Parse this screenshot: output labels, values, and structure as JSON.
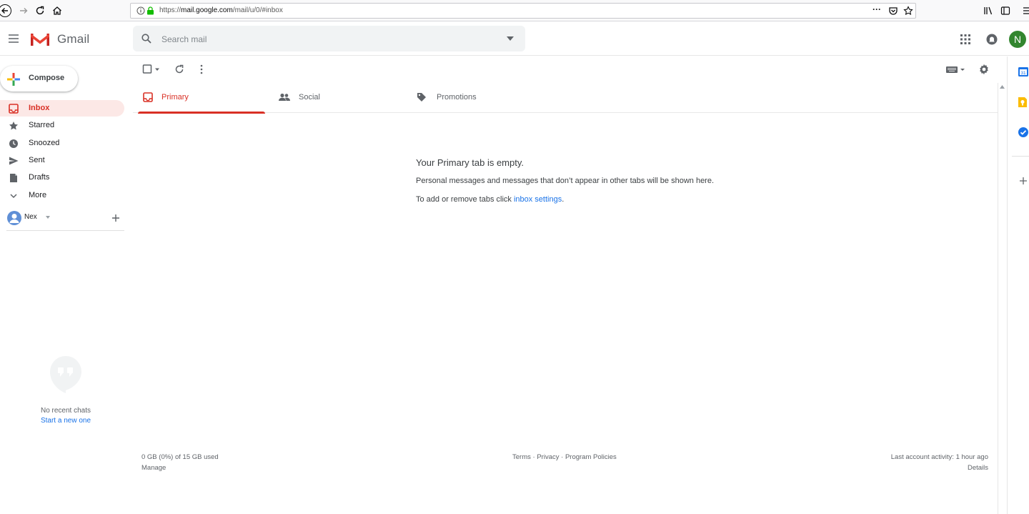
{
  "browser": {
    "url_prefix": "https://",
    "url_host": "mail.google.com",
    "url_path": "/mail/u/0/#inbox",
    "more_glyph": "···"
  },
  "app": {
    "name": "Gmail",
    "avatar_letter": "N",
    "search_placeholder": "Search mail"
  },
  "compose": {
    "label": "Compose"
  },
  "nav": [
    {
      "label": "Inbox",
      "icon": "inbox-icon",
      "active": true
    },
    {
      "label": "Starred",
      "icon": "star-icon"
    },
    {
      "label": "Snoozed",
      "icon": "clock-icon"
    },
    {
      "label": "Sent",
      "icon": "send-icon"
    },
    {
      "label": "Drafts",
      "icon": "draft-icon"
    },
    {
      "label": "More",
      "icon": "chevron-down-icon"
    }
  ],
  "hangouts": {
    "user": "Nex",
    "no_chats": "No recent chats",
    "start_link": "Start a new one"
  },
  "tabs": [
    {
      "label": "Primary",
      "icon": "inbox-icon",
      "active": true
    },
    {
      "label": "Social",
      "icon": "people-icon"
    },
    {
      "label": "Promotions",
      "icon": "tag-icon"
    }
  ],
  "empty": {
    "title": "Your Primary tab is empty.",
    "line1": "Personal messages and messages that don’t appear in other tabs will be shown here.",
    "line2_prefix": "To add or remove tabs click ",
    "line2_link": "inbox settings",
    "line2_suffix": "."
  },
  "footer": {
    "storage": "0 GB (0%) of 15 GB used",
    "manage": "Manage",
    "terms": "Terms",
    "privacy": "Privacy",
    "policies": "Program Policies",
    "sep": " · ",
    "activity": "Last account activity: 1 hour ago",
    "details": "Details"
  },
  "colors": {
    "accent_red": "#d93025",
    "link_blue": "#1a73e8",
    "avatar_green": "#33862f"
  }
}
